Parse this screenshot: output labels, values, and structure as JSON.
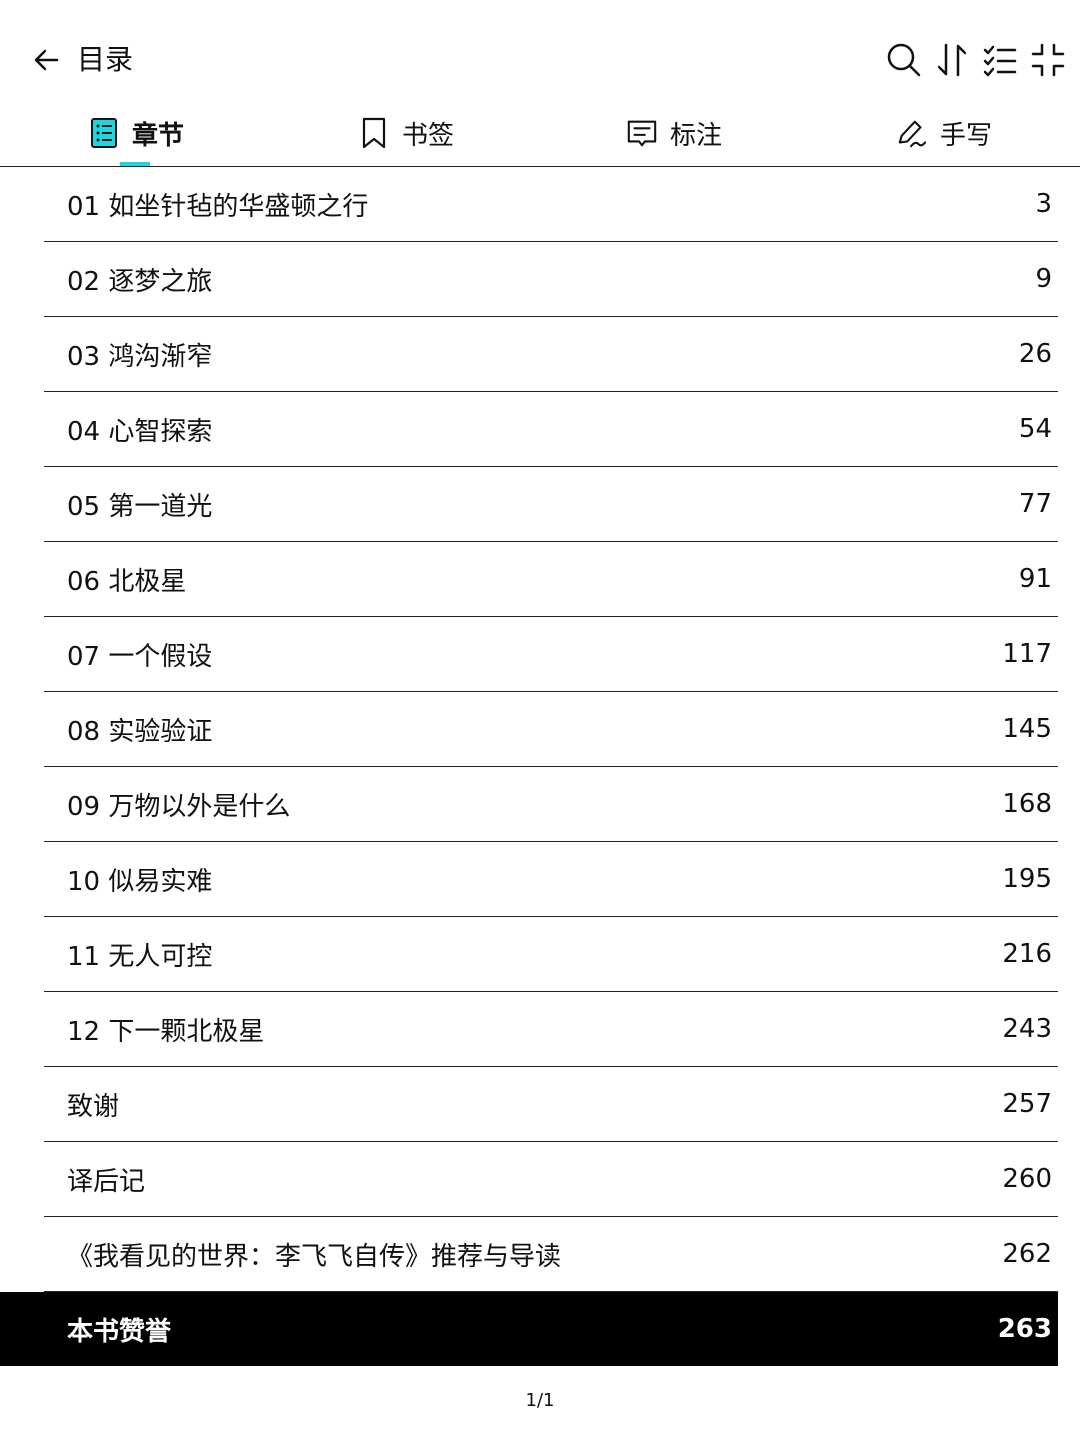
{
  "header": {
    "title": "目录",
    "icons": [
      "back-arrow-icon",
      "search-icon",
      "sort-icon",
      "checklist-icon",
      "collapse-icon"
    ]
  },
  "tabs": [
    {
      "label": "章节",
      "icon": "list-icon",
      "active": true
    },
    {
      "label": "书签",
      "icon": "bookmark-icon",
      "active": false
    },
    {
      "label": "标注",
      "icon": "note-icon",
      "active": false
    },
    {
      "label": "手写",
      "icon": "pen-icon",
      "active": false
    }
  ],
  "accent_color": "#19d6e0",
  "toc": [
    {
      "title": "01 如坐针毡的华盛顿之行",
      "page": "3"
    },
    {
      "title": "02 逐梦之旅",
      "page": "9"
    },
    {
      "title": "03 鸿沟渐窄",
      "page": "26"
    },
    {
      "title": "04 心智探索",
      "page": "54"
    },
    {
      "title": "05 第一道光",
      "page": "77"
    },
    {
      "title": "06 北极星",
      "page": "91"
    },
    {
      "title": "07 一个假设",
      "page": "117"
    },
    {
      "title": "08 实验验证",
      "page": "145"
    },
    {
      "title": "09 万物以外是什么",
      "page": "168"
    },
    {
      "title": "10 似易实难",
      "page": "195"
    },
    {
      "title": "11 无人可控",
      "page": "216"
    },
    {
      "title": "12 下一颗北极星",
      "page": "243"
    },
    {
      "title": "致谢",
      "page": "257"
    },
    {
      "title": "译后记",
      "page": "260"
    },
    {
      "title": "《我看见的世界：李飞飞自传》推荐与导读",
      "page": "262"
    },
    {
      "title": "本书赞誉",
      "page": "263",
      "selected": true
    }
  ],
  "pager": "1/1"
}
